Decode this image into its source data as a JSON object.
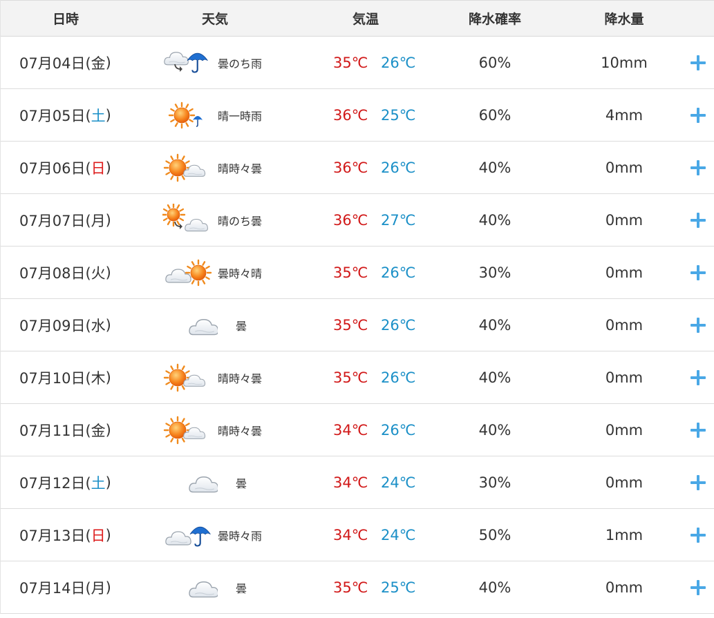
{
  "header": {
    "date": "日時",
    "weather": "天気",
    "temp": "気温",
    "precip_prob": "降水確率",
    "precip_amount": "降水量"
  },
  "rows": [
    {
      "date": "07月04日(",
      "dow": "金",
      "close": ")",
      "dow_type": "weekday",
      "icon": "cloud-then-rain",
      "weather": "曇のち雨",
      "high": "35℃",
      "low": "26℃",
      "prob": "60%",
      "amount": "10mm"
    },
    {
      "date": "07月05日(",
      "dow": "土",
      "close": ")",
      "dow_type": "sat",
      "icon": "sun-occasional-rain",
      "weather": "晴一時雨",
      "high": "36℃",
      "low": "25℃",
      "prob": "60%",
      "amount": "4mm"
    },
    {
      "date": "07月06日(",
      "dow": "日",
      "close": ")",
      "dow_type": "sun",
      "icon": "sun-sometimes-cloud",
      "weather": "晴時々曇",
      "high": "36℃",
      "low": "26℃",
      "prob": "40%",
      "amount": "0mm"
    },
    {
      "date": "07月07日(",
      "dow": "月",
      "close": ")",
      "dow_type": "weekday",
      "icon": "sun-then-cloud",
      "weather": "晴のち曇",
      "high": "36℃",
      "low": "27℃",
      "prob": "40%",
      "amount": "0mm"
    },
    {
      "date": "07月08日(",
      "dow": "火",
      "close": ")",
      "dow_type": "weekday",
      "icon": "cloud-sometimes-sun",
      "weather": "曇時々晴",
      "high": "35℃",
      "low": "26℃",
      "prob": "30%",
      "amount": "0mm"
    },
    {
      "date": "07月09日(",
      "dow": "水",
      "close": ")",
      "dow_type": "weekday",
      "icon": "cloud",
      "weather": "曇",
      "high": "35℃",
      "low": "26℃",
      "prob": "40%",
      "amount": "0mm"
    },
    {
      "date": "07月10日(",
      "dow": "木",
      "close": ")",
      "dow_type": "weekday",
      "icon": "sun-sometimes-cloud",
      "weather": "晴時々曇",
      "high": "35℃",
      "low": "26℃",
      "prob": "40%",
      "amount": "0mm"
    },
    {
      "date": "07月11日(",
      "dow": "金",
      "close": ")",
      "dow_type": "weekday",
      "icon": "sun-sometimes-cloud",
      "weather": "晴時々曇",
      "high": "34℃",
      "low": "26℃",
      "prob": "40%",
      "amount": "0mm"
    },
    {
      "date": "07月12日(",
      "dow": "土",
      "close": ")",
      "dow_type": "sat",
      "icon": "cloud",
      "weather": "曇",
      "high": "34℃",
      "low": "24℃",
      "prob": "30%",
      "amount": "0mm"
    },
    {
      "date": "07月13日(",
      "dow": "日",
      "close": ")",
      "dow_type": "sun",
      "icon": "cloud-sometimes-rain",
      "weather": "曇時々雨",
      "high": "34℃",
      "low": "24℃",
      "prob": "50%",
      "amount": "1mm"
    },
    {
      "date": "07月14日(",
      "dow": "月",
      "close": ")",
      "dow_type": "weekday",
      "icon": "cloud",
      "weather": "曇",
      "high": "35℃",
      "low": "25℃",
      "prob": "40%",
      "amount": "0mm"
    }
  ],
  "colors": {
    "high_temp": "#d11818",
    "low_temp": "#1a8fc7",
    "saturday": "#1a8fc7",
    "sunday": "#dd1a1a",
    "expand_button": "#4aa8e6"
  }
}
